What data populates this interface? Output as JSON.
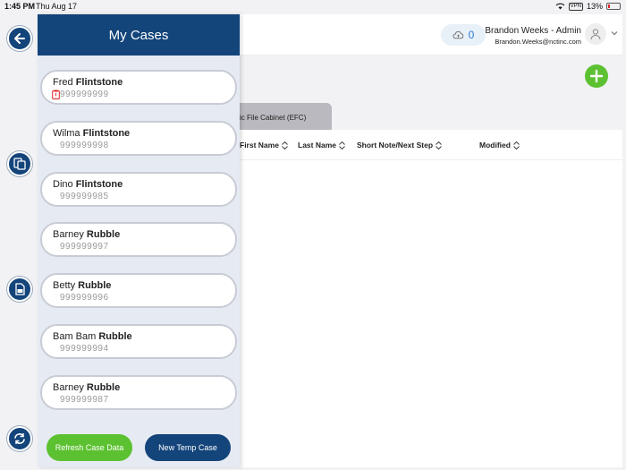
{
  "status_bar": {
    "time": "1:45 PM",
    "date": "Thu Aug 17",
    "vpn": "VPN",
    "battery": "13%"
  },
  "header": {
    "sync_count": "0",
    "user_name": "Brandon Weeks - Admin",
    "user_email": "Brandon.Weeks@nctinc.com"
  },
  "tab": {
    "label": "ic File Cabinet (EFC)"
  },
  "table": {
    "columns": [
      "First Name",
      "Last Name",
      "Short Note/Next Step",
      "Modified"
    ]
  },
  "drawer": {
    "title": "My Cases",
    "cases": [
      {
        "first": "Fred",
        "last": "Flintstone",
        "number": "999999999",
        "flagged": true
      },
      {
        "first": "Wilma",
        "last": "Flintstone",
        "number": "999999998",
        "flagged": false
      },
      {
        "first": "Dino",
        "last": "Flintstone",
        "number": "999999985",
        "flagged": false
      },
      {
        "first": "Barney",
        "last": "Rubble",
        "number": "999999997",
        "flagged": false
      },
      {
        "first": "Betty",
        "last": "Rubble",
        "number": "999999996",
        "flagged": false
      },
      {
        "first": "Bam Bam",
        "last": "Rubble",
        "number": "999999994",
        "flagged": false
      },
      {
        "first": "Barney",
        "last": "Rubble",
        "number": "999999987",
        "flagged": false
      }
    ],
    "refresh_label": "Refresh Case Data",
    "temp_label": "New Temp Case"
  },
  "colors": {
    "primary": "#13447a",
    "accent_green": "#5cc130",
    "sync_blue": "#2a7bd5"
  },
  "icons": {
    "rail": [
      "back-arrow-icon",
      "switch-screens-icon",
      "document-scan-icon",
      "sync-icon"
    ]
  }
}
